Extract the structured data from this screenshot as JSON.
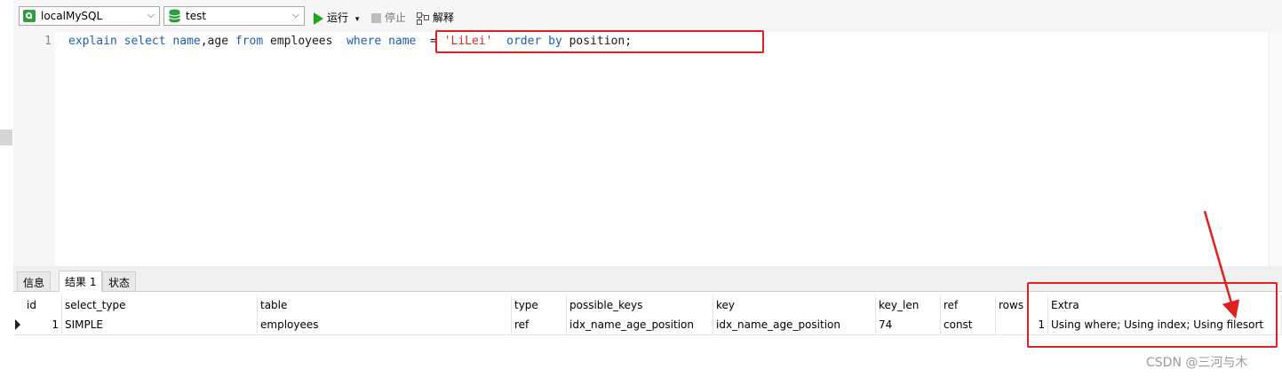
{
  "toolbar": {
    "connection": "localMySQL",
    "database": "test",
    "run_label": "运行",
    "stop_label": "停止",
    "explain_label": "解释"
  },
  "editor": {
    "line_number": "1",
    "tokens": [
      {
        "t": "explain",
        "c": "kw"
      },
      {
        "t": " ",
        "c": "id"
      },
      {
        "t": "select",
        "c": "kw"
      },
      {
        "t": " ",
        "c": "id"
      },
      {
        "t": "name",
        "c": "kw"
      },
      {
        "t": ",age ",
        "c": "id"
      },
      {
        "t": "from",
        "c": "kw"
      },
      {
        "t": " employees  ",
        "c": "id"
      },
      {
        "t": "where",
        "c": "kw"
      },
      {
        "t": " ",
        "c": "id"
      },
      {
        "t": "name",
        "c": "kw"
      },
      {
        "t": "  = ",
        "c": "id"
      },
      {
        "t": "'LiLei'",
        "c": "str"
      },
      {
        "t": "  ",
        "c": "id"
      },
      {
        "t": "order",
        "c": "kw"
      },
      {
        "t": " ",
        "c": "id"
      },
      {
        "t": "by",
        "c": "kw"
      },
      {
        "t": " position;",
        "c": "id"
      }
    ]
  },
  "tabs": [
    "信息",
    "结果 1",
    "状态"
  ],
  "active_tab": "结果 1",
  "result": {
    "columns": [
      "id",
      "select_type",
      "table",
      "type",
      "possible_keys",
      "key",
      "key_len",
      "ref",
      "rows",
      "Extra"
    ],
    "rows": [
      [
        "1",
        "SIMPLE",
        "employees",
        "ref",
        "idx_name_age_position",
        "idx_name_age_position",
        "74",
        "const",
        "1",
        "Using where; Using index; Using filesort"
      ]
    ]
  },
  "colors": {
    "keyword": "#1a5fb4",
    "string": "#d32b2b",
    "highlight_box": "#e02020"
  },
  "watermark": "CSDN @三河与木"
}
